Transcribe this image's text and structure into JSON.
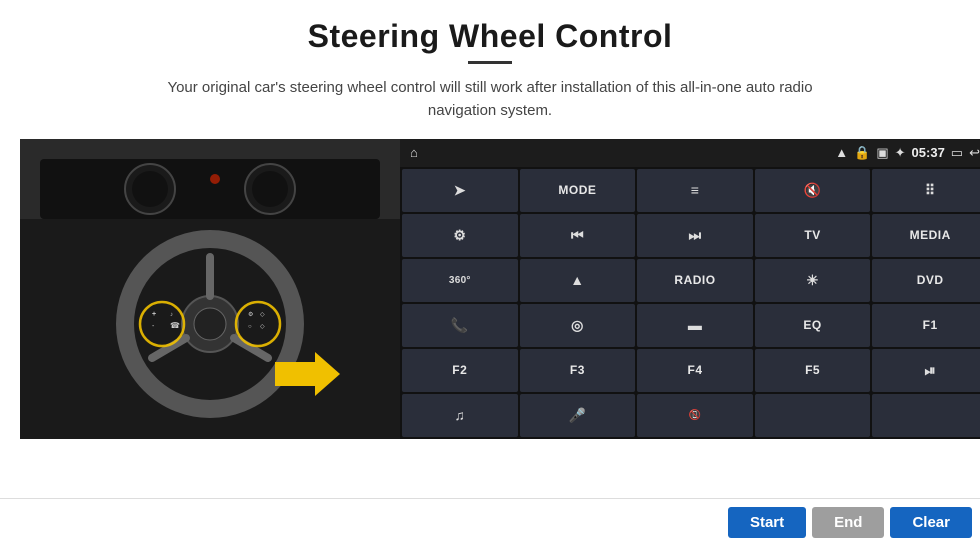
{
  "page": {
    "title": "Steering Wheel Control",
    "subtitle": "Your original car's steering wheel control will still work after installation of this all-in-one auto radio navigation system.",
    "divider": true
  },
  "status_bar": {
    "time": "05:37",
    "icons": [
      "home",
      "wifi",
      "lock",
      "sd",
      "bluetooth",
      "screenshot",
      "back"
    ]
  },
  "grid_buttons": [
    {
      "id": "r1c1",
      "type": "icon",
      "icon": "▷",
      "label": "nav"
    },
    {
      "id": "r1c2",
      "type": "text",
      "label": "MODE"
    },
    {
      "id": "r1c3",
      "type": "icon",
      "icon": "☰",
      "label": "list"
    },
    {
      "id": "r1c4",
      "type": "icon",
      "icon": "🔇",
      "label": "mute"
    },
    {
      "id": "r1c5",
      "type": "icon",
      "icon": "⠿",
      "label": "apps"
    },
    {
      "id": "r2c1",
      "type": "icon",
      "icon": "⊙",
      "label": "settings"
    },
    {
      "id": "r2c2",
      "type": "icon",
      "icon": "⏮",
      "label": "prev"
    },
    {
      "id": "r2c3",
      "type": "icon",
      "icon": "⏭",
      "label": "next"
    },
    {
      "id": "r2c4",
      "type": "text",
      "label": "TV"
    },
    {
      "id": "r2c5",
      "type": "text",
      "label": "MEDIA"
    },
    {
      "id": "r3c1",
      "type": "icon",
      "icon": "📷",
      "label": "camera360"
    },
    {
      "id": "r3c2",
      "type": "icon",
      "icon": "▲",
      "label": "eject"
    },
    {
      "id": "r3c3",
      "type": "text",
      "label": "RADIO"
    },
    {
      "id": "r3c4",
      "type": "icon",
      "icon": "☀",
      "label": "brightness"
    },
    {
      "id": "r3c5",
      "type": "text",
      "label": "DVD"
    },
    {
      "id": "r4c1",
      "type": "icon",
      "icon": "📞",
      "label": "phone"
    },
    {
      "id": "r4c2",
      "type": "icon",
      "icon": "◎",
      "label": "circle"
    },
    {
      "id": "r4c3",
      "type": "icon",
      "icon": "▬",
      "label": "bar"
    },
    {
      "id": "r4c4",
      "type": "text",
      "label": "EQ"
    },
    {
      "id": "r4c5",
      "type": "text",
      "label": "F1"
    },
    {
      "id": "r5c1",
      "type": "text",
      "label": "F2"
    },
    {
      "id": "r5c2",
      "type": "text",
      "label": "F3"
    },
    {
      "id": "r5c3",
      "type": "text",
      "label": "F4"
    },
    {
      "id": "r5c4",
      "type": "text",
      "label": "F5"
    },
    {
      "id": "r5c5",
      "type": "icon",
      "icon": "⏯",
      "label": "playpause"
    },
    {
      "id": "r6c1",
      "type": "icon",
      "icon": "♫",
      "label": "music"
    },
    {
      "id": "r6c2",
      "type": "icon",
      "icon": "🎤",
      "label": "mic"
    },
    {
      "id": "r6c3",
      "type": "icon",
      "icon": "📵",
      "label": "call-end"
    },
    {
      "id": "r6c4",
      "type": "empty",
      "label": ""
    },
    {
      "id": "r6c5",
      "type": "empty",
      "label": ""
    }
  ],
  "bottom_bar": {
    "start_label": "Start",
    "end_label": "End",
    "clear_label": "Clear"
  }
}
